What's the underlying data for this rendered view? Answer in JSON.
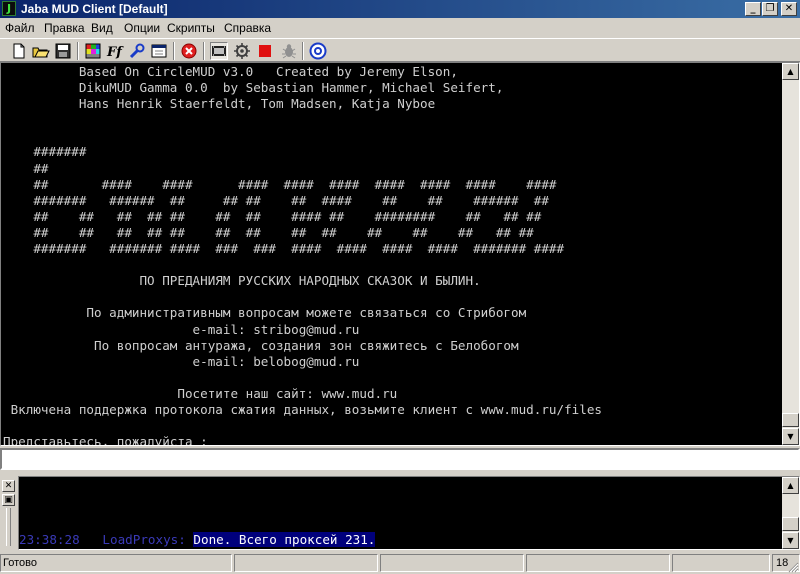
{
  "window": {
    "title": "Jaba MUD Client [Default]",
    "icon": "J",
    "controls": {
      "minimize": "_",
      "maximize": "❐",
      "close": "✕"
    }
  },
  "menu": [
    "Файл",
    "Правка",
    "Вид",
    "Опции",
    "Скрипты",
    "Справка"
  ],
  "toolbar_icons": [
    "new-file-icon",
    "open-folder-icon",
    "save-disk-icon",
    "color-palette-icon",
    "font-icon",
    "wrench-icon",
    "window-icon",
    "disconnect-icon",
    "log-film-icon",
    "settings-gear-icon",
    "stop-icon",
    "bug-icon",
    "help-circle-icon"
  ],
  "terminal": {
    "lines": [
      "          Based On CircleMUD v3.0   Created by Jeremy Elson,",
      "          DikuMUD Gamma 0.0  by Sebastian Hammer, Michael Seifert,",
      "          Hans Henrik Staerfeldt, Tom Madsen, Katja Nyboe",
      "",
      "",
      "    #######",
      "    ##",
      "    ##       ####    ####      ####  ####  ####  ####  ####  ####    ####",
      "    #######   ######  ##     ## ##    ##  ####    ##    ##    ######  ##",
      "    ##    ##   ##  ## ##    ##  ##    #### ##    ########    ##   ## ##",
      "    ##    ##   ##  ## ##    ##  ##    ##  ##    ##    ##    ##   ## ##",
      "    #######   ####### ####  ###  ###  ####  ####  ####  ####  ####### ####",
      "",
      "                  ПО ПРЕДАНИЯМ РУССКИХ НАРОДНЫХ СКАЗОК И БЫЛИН.",
      "",
      "           По административным вопросам можете связаться со Стрибогом",
      "                         e-mail: stribog@mud.ru",
      "            По вопросам антуража, создания зон свяжитесь с Белобогом",
      "                         e-mail: belobog@mud.ru",
      "",
      "                       Посетите наш сайт: www.mud.ru",
      " Включена поддержка протокола сжатия данных, возьмите клиент с www.mud.ru/files",
      "",
      "Представьтесь, пожалуйста :"
    ]
  },
  "input": {
    "value": ""
  },
  "log": {
    "time": "23:38:28",
    "source": "LoadProxys:",
    "message": "Done. Всего проксей 231."
  },
  "statusbar": {
    "status": "Готово",
    "value": "18"
  },
  "colors": {
    "title_start": "#0a246a",
    "title_end": "#3a6ea5",
    "terminal_bg": "#000000",
    "terminal_text": "#cfcfcf",
    "log_highlight": "#00007c"
  }
}
